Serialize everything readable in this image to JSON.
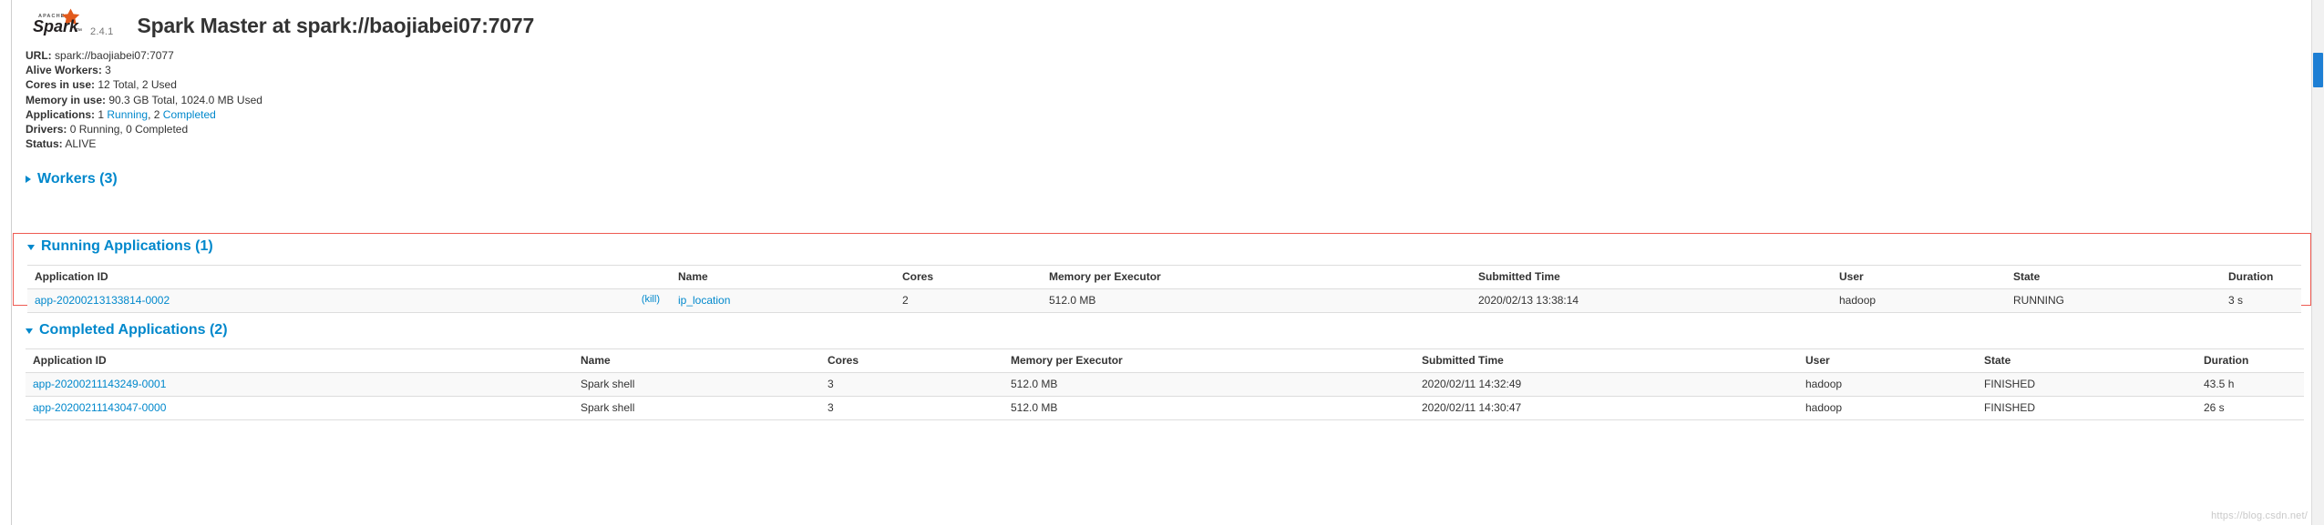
{
  "header": {
    "logo_alt": "Apache Spark",
    "logo_apache_text": "APACHE",
    "logo_word": "Spark",
    "version": "2.4.1",
    "title": "Spark Master at spark://baojiabei07:7077"
  },
  "summary": {
    "url": {
      "label": "URL:",
      "value": "spark://baojiabei07:7077"
    },
    "alive_workers": {
      "label": "Alive Workers:",
      "value": "3"
    },
    "cores": {
      "label": "Cores in use:",
      "value": "12 Total, 2 Used"
    },
    "memory": {
      "label": "Memory in use:",
      "value": "90.3 GB Total, 1024.0 MB Used"
    },
    "applications": {
      "label": "Applications:",
      "running_count": "1",
      "running_link": "Running",
      "separator": ", ",
      "completed_count": "2",
      "completed_link": "Completed"
    },
    "drivers": {
      "label": "Drivers:",
      "value": "0 Running, 0 Completed"
    },
    "status": {
      "label": "Status:",
      "value": "ALIVE"
    }
  },
  "workers_section": {
    "title": "Workers (3)",
    "expanded": false,
    "caret_icon": "caret-right-icon"
  },
  "running_section": {
    "title": "Running Applications (1)",
    "expanded": true,
    "caret_icon": "caret-down-icon",
    "columns": [
      "Application ID",
      "Name",
      "Cores",
      "Memory per Executor",
      "Submitted Time",
      "User",
      "State",
      "Duration"
    ],
    "rows": [
      {
        "app_id": "app-20200213133814-0002",
        "kill_label": "(kill)",
        "name": "ip_location",
        "cores": "2",
        "memory": "512.0 MB",
        "submitted": "2020/02/13 13:38:14",
        "user": "hadoop",
        "state": "RUNNING",
        "duration": "3 s"
      }
    ]
  },
  "completed_section": {
    "title": "Completed Applications (2)",
    "expanded": true,
    "caret_icon": "caret-down-icon",
    "columns": [
      "Application ID",
      "Name",
      "Cores",
      "Memory per Executor",
      "Submitted Time",
      "User",
      "State",
      "Duration"
    ],
    "rows": [
      {
        "app_id": "app-20200211143249-0001",
        "name": "Spark shell",
        "cores": "3",
        "memory": "512.0 MB",
        "submitted": "2020/02/11 14:32:49",
        "user": "hadoop",
        "state": "FINISHED",
        "duration": "43.5 h"
      },
      {
        "app_id": "app-20200211143047-0000",
        "name": "Spark shell",
        "cores": "3",
        "memory": "512.0 MB",
        "submitted": "2020/02/11 14:30:47",
        "user": "hadoop",
        "state": "FINISHED",
        "duration": "26 s"
      }
    ]
  },
  "watermark": "https://blog.csdn.net/",
  "colors": {
    "link": "#0088cc",
    "highlight_border": "#ee5a52",
    "scrollbar_thumb": "#1e7fd4",
    "logo_star": "#e25a1c"
  }
}
